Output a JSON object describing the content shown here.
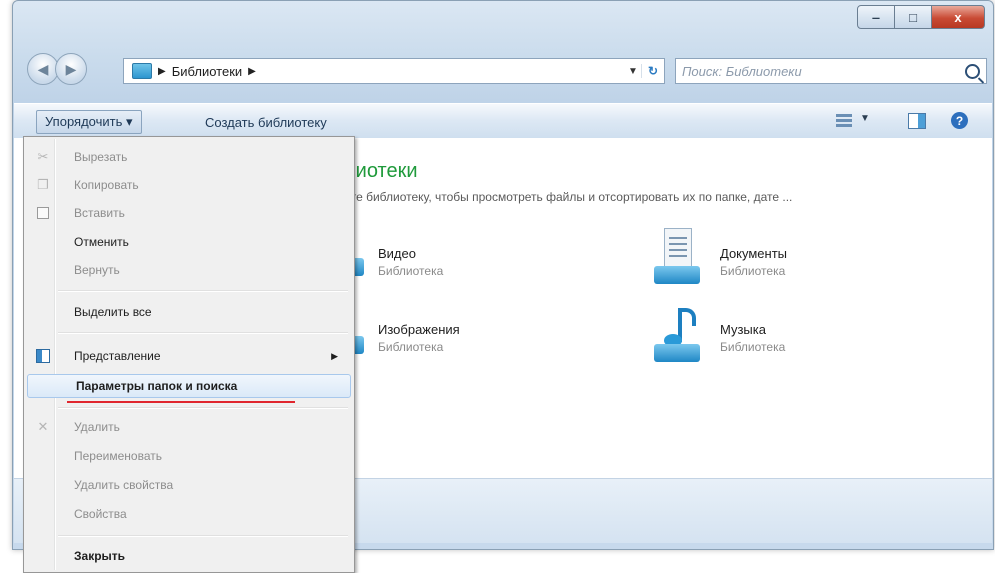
{
  "window": {
    "caption_buttons": {
      "minimize": "‒",
      "maximize": "□",
      "close": "x"
    }
  },
  "address_bar": {
    "breadcrumb": "Библиотеки",
    "search_placeholder": "Поиск: Библиотеки"
  },
  "toolbar": {
    "organize": "Упорядочить ▾",
    "create_library": "Создать библиотеку"
  },
  "content": {
    "title": "лиотеки",
    "description": "йте библиотеку, чтобы просмотреть файлы и отсортировать их по папке, дате ...",
    "libraries": [
      {
        "name": "Видео",
        "type": "Библиотека"
      },
      {
        "name": "Документы",
        "type": "Библиотека"
      },
      {
        "name": "Изображения",
        "type": "Библиотека"
      },
      {
        "name": "Музыка",
        "type": "Библиотека"
      }
    ]
  },
  "menu": {
    "items": [
      {
        "label": "Вырезать",
        "state": "disabled"
      },
      {
        "label": "Копировать",
        "state": "disabled"
      },
      {
        "label": "Вставить",
        "state": "disabled"
      },
      {
        "label": "Отменить",
        "state": "enabled"
      },
      {
        "label": "Вернуть",
        "state": "disabled"
      },
      {
        "label": "Выделить все",
        "state": "enabled"
      },
      {
        "label": "Представление",
        "state": "enabled",
        "submenu": true
      },
      {
        "label": "Параметры папок и поиска",
        "state": "highlighted"
      },
      {
        "label": "Удалить",
        "state": "disabled"
      },
      {
        "label": "Переименовать",
        "state": "disabled"
      },
      {
        "label": "Удалить свойства",
        "state": "disabled"
      },
      {
        "label": "Свойства",
        "state": "disabled"
      },
      {
        "label": "Закрыть",
        "state": "enabled"
      }
    ],
    "submenu_arrow": "▶"
  },
  "colors": {
    "title_green": "#1f9a3b",
    "annotation_underline": "#e0262e",
    "highlight_border": "#a8c8ec"
  }
}
